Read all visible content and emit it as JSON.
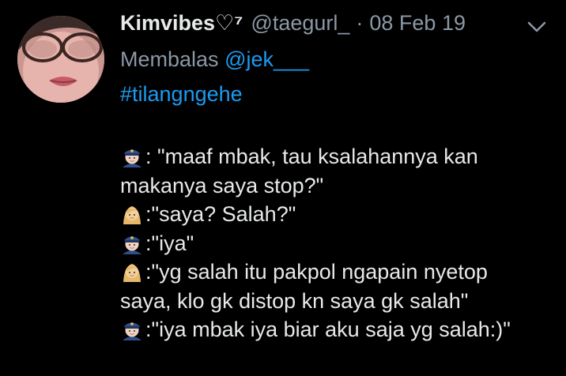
{
  "tweet": {
    "display_name": "Kimvibes♡⁷",
    "handle": "@taegurl_",
    "separator": "·",
    "date": "08 Feb 19",
    "reply_prefix": "Membalas",
    "reply_mention": "@jek___",
    "hashtag": "#tilangngehe",
    "lines": [
      {
        "emoji": "police-officer",
        "text": ": \"maaf mbak, tau ksalahannya kan"
      },
      {
        "emoji": "",
        "text": "makanya saya stop?\""
      },
      {
        "emoji": "woman",
        "text": ":\"saya? Salah?\""
      },
      {
        "emoji": "police-officer",
        "text": ":\"iya\""
      },
      {
        "emoji": "woman",
        "text": ":\"yg salah itu pakpol ngapain nyetop"
      },
      {
        "emoji": "",
        "text": "saya, klo gk distop kn saya gk salah\""
      },
      {
        "emoji": "police-officer",
        "text": ":\"iya mbak iya biar aku saja yg salah:)\""
      }
    ]
  },
  "colors": {
    "background": "#000000",
    "text": "#e7e9ea",
    "secondary": "#8b98a5",
    "link": "#1d9bf0"
  },
  "icons": {
    "menu": "chevron-down-icon",
    "avatar": "profile-photo"
  }
}
